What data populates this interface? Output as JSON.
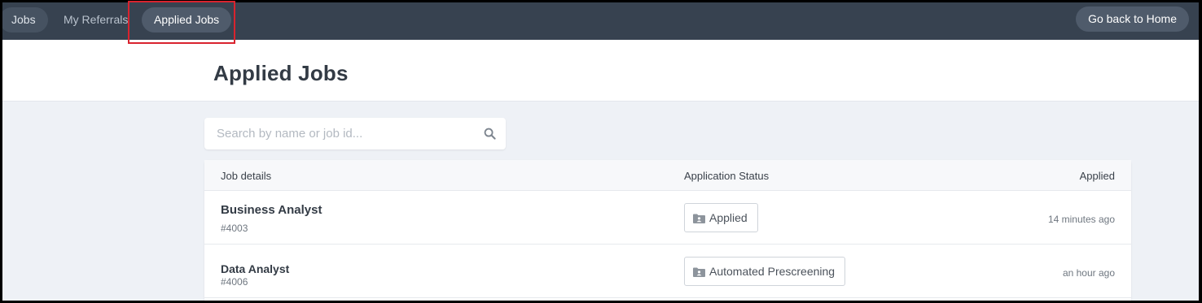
{
  "nav": {
    "items": [
      {
        "label": "Jobs"
      },
      {
        "label": "My Referrals"
      },
      {
        "label": "Applied Jobs"
      }
    ],
    "home_button": "Go back to Home"
  },
  "page": {
    "title": "Applied Jobs"
  },
  "search": {
    "placeholder": "Search by name or job id..."
  },
  "table": {
    "headers": {
      "details": "Job details",
      "status": "Application Status",
      "applied": "Applied"
    },
    "rows": [
      {
        "title": "Business Analyst",
        "id": "#4003",
        "status": "Applied",
        "time": "14 minutes ago"
      },
      {
        "title": "Data Analyst",
        "id": "#4006",
        "status": "Automated Prescreening",
        "time": "an hour ago"
      }
    ]
  },
  "icons": {
    "search": "search-icon",
    "status": "folder-person-icon"
  },
  "colors": {
    "nav_bg": "#374250",
    "highlight": "#d9232e"
  }
}
